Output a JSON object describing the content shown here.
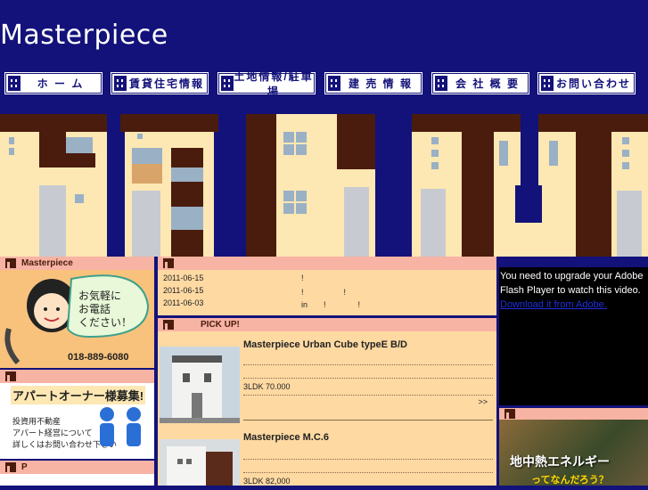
{
  "site": {
    "logo": "Masterpiece"
  },
  "nav": [
    {
      "label": "ホ ー ム"
    },
    {
      "label": "賃貸住宅情報"
    },
    {
      "label": "土地情報/駐車場"
    },
    {
      "label": "建 売 情 報"
    },
    {
      "label": "会 社 概 要"
    },
    {
      "label": "お問い合わせ"
    }
  ],
  "sidebar": {
    "section1_title": "Masterpiece",
    "phone_bubble": "お気軽に\nお電話\nください！",
    "phone_number": "018-889-6080",
    "section2_title": "",
    "owner_title": "アパートオーナー様募集!",
    "owner_lines": [
      "投資用不動産",
      "アパート経営について",
      "詳しくはお問い合わせ下さい"
    ],
    "section3_title": "P"
  },
  "news": [
    {
      "date": "2011-06-15",
      "text": "!"
    },
    {
      "date": "2011-06-15",
      "text": "!　　　　　!"
    },
    {
      "date": "2011-06-03",
      "text": "in　　!　　　　!"
    }
  ],
  "pickup": {
    "title": "PICK UP!",
    "items": [
      {
        "name": "Masterpiece Urban Cube typeE  B/D",
        "info": "3LDK 70.000",
        "more": ">>"
      },
      {
        "name": "Masterpiece M.C.6",
        "info": "3LDK 82,000",
        "more": ""
      }
    ]
  },
  "flash": {
    "message": "You need to upgrade your Adobe Flash Player to watch this video.",
    "link": "Download it from Adobe."
  },
  "banner": {
    "line1": "地中熱エネルギー",
    "line2": "ってなんだろう？"
  }
}
